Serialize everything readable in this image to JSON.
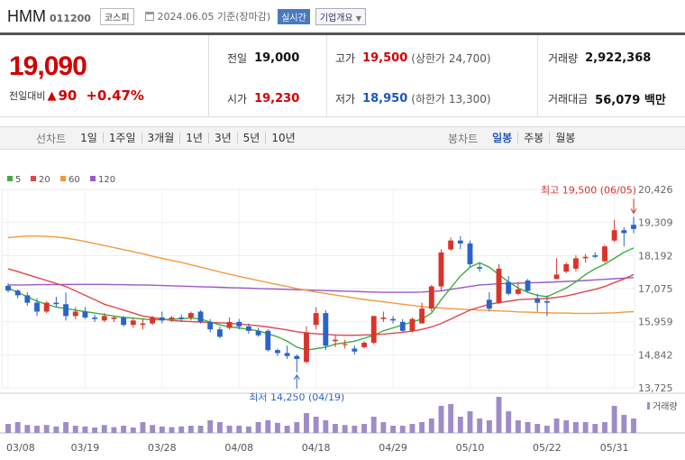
{
  "header": {
    "name": "HMM",
    "code": "011200",
    "market": "코스피",
    "date": "2024.06.05 기준(장마감)",
    "live_label": "실시간",
    "company_label": "기업개요"
  },
  "quote": {
    "price": "19,090",
    "change_label": "전일대비",
    "change_value": "90",
    "change_percent": "+0.47%",
    "prev_close_label": "전일",
    "prev_close": "19,000",
    "high_label": "고가",
    "high": "19,500",
    "upper_limit": "(상한가 24,700)",
    "volume_label": "거래량",
    "volume": "2,922,368",
    "open_label": "시가",
    "open": "19,230",
    "low_label": "저가",
    "low": "18,950",
    "lower_limit": "(하한가 13,300)",
    "trade_value_label": "거래대금",
    "trade_value": "56,079 백만"
  },
  "toolbar": {
    "line_chart_label": "선차트",
    "periods": [
      "1일",
      "1주일",
      "3개월",
      "1년",
      "3년",
      "5년",
      "10년"
    ],
    "candle_label": "봉차트",
    "candle_periods": [
      "일봉",
      "주봉",
      "월봉"
    ],
    "active_candle": "일봉"
  },
  "colors": {
    "up": "#d9342b",
    "down": "#2a64c8",
    "ma5": "#3dae3d",
    "ma20": "#e0474c",
    "ma60": "#f29a3c",
    "ma120": "#9a59c9",
    "volume": "#9d8cc8"
  },
  "chart_data": {
    "type": "candlestick",
    "y_ticks": [
      "20,426",
      "19,309",
      "18,192",
      "17,075",
      "15,959",
      "14,842",
      "13,725"
    ],
    "ylim": [
      13725,
      20426
    ],
    "x_ticks": [
      "03/08",
      "03/19",
      "03/28",
      "04/08",
      "04/18",
      "04/29",
      "05/10",
      "05/22",
      "05/31"
    ],
    "legend": [
      "5",
      "20",
      "60",
      "120"
    ],
    "high_annotation": "최고 19,500 (06/05)",
    "low_annotation": "최저 14,250 (04/19)",
    "volume_label": "거래량",
    "candles": [
      {
        "o": 17170,
        "h": 17250,
        "l": 16950,
        "c": 17010
      },
      {
        "o": 17010,
        "h": 17050,
        "l": 16750,
        "c": 16850
      },
      {
        "o": 16850,
        "h": 16950,
        "l": 16500,
        "c": 16600
      },
      {
        "o": 16600,
        "h": 16750,
        "l": 16150,
        "c": 16300
      },
      {
        "o": 16300,
        "h": 16650,
        "l": 16250,
        "c": 16600
      },
      {
        "o": 16600,
        "h": 16800,
        "l": 16450,
        "c": 16550
      },
      {
        "o": 16550,
        "h": 16950,
        "l": 16000,
        "c": 16150
      },
      {
        "o": 16150,
        "h": 16450,
        "l": 16050,
        "c": 16300
      },
      {
        "o": 16300,
        "h": 16450,
        "l": 16050,
        "c": 16100
      },
      {
        "o": 16100,
        "h": 16200,
        "l": 15950,
        "c": 16050
      },
      {
        "o": 16000,
        "h": 16250,
        "l": 15950,
        "c": 16150
      },
      {
        "o": 16050,
        "h": 16150,
        "l": 15950,
        "c": 16100
      },
      {
        "o": 16100,
        "h": 16150,
        "l": 15800,
        "c": 15850
      },
      {
        "o": 15850,
        "h": 16100,
        "l": 15750,
        "c": 16000
      },
      {
        "o": 15850,
        "h": 16050,
        "l": 15700,
        "c": 15900
      },
      {
        "o": 15900,
        "h": 16150,
        "l": 15850,
        "c": 16100
      },
      {
        "o": 16100,
        "h": 16300,
        "l": 15900,
        "c": 16000
      },
      {
        "o": 16050,
        "h": 16150,
        "l": 15950,
        "c": 16100
      },
      {
        "o": 16100,
        "h": 16200,
        "l": 15950,
        "c": 16050
      },
      {
        "o": 16100,
        "h": 16300,
        "l": 16000,
        "c": 16250
      },
      {
        "o": 16300,
        "h": 16350,
        "l": 15900,
        "c": 15950
      },
      {
        "o": 15950,
        "h": 16050,
        "l": 15600,
        "c": 15700
      },
      {
        "o": 15700,
        "h": 15800,
        "l": 15400,
        "c": 15450
      },
      {
        "o": 15750,
        "h": 16100,
        "l": 15700,
        "c": 15950
      },
      {
        "o": 15950,
        "h": 16050,
        "l": 15700,
        "c": 15800
      },
      {
        "o": 15800,
        "h": 15900,
        "l": 15550,
        "c": 15650
      },
      {
        "o": 15650,
        "h": 15750,
        "l": 15450,
        "c": 15500
      },
      {
        "o": 15650,
        "h": 15700,
        "l": 14950,
        "c": 15000
      },
      {
        "o": 15000,
        "h": 15050,
        "l": 14800,
        "c": 14900
      },
      {
        "o": 14900,
        "h": 15150,
        "l": 14700,
        "c": 14800
      },
      {
        "o": 14800,
        "h": 14850,
        "l": 14250,
        "c": 14700
      },
      {
        "o": 14600,
        "h": 15800,
        "l": 14550,
        "c": 15600
      },
      {
        "o": 15850,
        "h": 16450,
        "l": 15700,
        "c": 16250
      },
      {
        "o": 16250,
        "h": 16350,
        "l": 15000,
        "c": 15150
      },
      {
        "o": 15300,
        "h": 15500,
        "l": 15100,
        "c": 15350
      },
      {
        "o": 15200,
        "h": 15350,
        "l": 15050,
        "c": 15200
      },
      {
        "o": 15050,
        "h": 15150,
        "l": 14850,
        "c": 14950
      },
      {
        "o": 15100,
        "h": 15300,
        "l": 15050,
        "c": 15250
      },
      {
        "o": 15250,
        "h": 16150,
        "l": 15200,
        "c": 16150
      },
      {
        "o": 16050,
        "h": 16300,
        "l": 15950,
        "c": 16100
      },
      {
        "o": 16050,
        "h": 16150,
        "l": 15900,
        "c": 16000
      },
      {
        "o": 15950,
        "h": 16050,
        "l": 15600,
        "c": 15650
      },
      {
        "o": 15650,
        "h": 16100,
        "l": 15600,
        "c": 16050
      },
      {
        "o": 15900,
        "h": 16600,
        "l": 15900,
        "c": 16400
      },
      {
        "o": 16400,
        "h": 17200,
        "l": 16300,
        "c": 17150
      },
      {
        "o": 17150,
        "h": 18400,
        "l": 17000,
        "c": 18300
      },
      {
        "o": 18400,
        "h": 18800,
        "l": 18350,
        "c": 18700
      },
      {
        "o": 18700,
        "h": 18850,
        "l": 18400,
        "c": 18600
      },
      {
        "o": 18600,
        "h": 18700,
        "l": 17800,
        "c": 17900
      },
      {
        "o": 17800,
        "h": 17950,
        "l": 17650,
        "c": 17750
      },
      {
        "o": 16700,
        "h": 16950,
        "l": 16300,
        "c": 16400
      },
      {
        "o": 16600,
        "h": 17900,
        "l": 16550,
        "c": 17750
      },
      {
        "o": 17300,
        "h": 17500,
        "l": 16850,
        "c": 16900
      },
      {
        "o": 16900,
        "h": 17300,
        "l": 16850,
        "c": 17050
      },
      {
        "o": 17350,
        "h": 17400,
        "l": 16950,
        "c": 17000
      },
      {
        "o": 16750,
        "h": 16900,
        "l": 16300,
        "c": 16600
      },
      {
        "o": 16650,
        "h": 16850,
        "l": 16150,
        "c": 16600
      },
      {
        "o": 17400,
        "h": 18100,
        "l": 17400,
        "c": 17550
      },
      {
        "o": 17650,
        "h": 17950,
        "l": 17600,
        "c": 17900
      },
      {
        "o": 17750,
        "h": 18200,
        "l": 17650,
        "c": 18100
      },
      {
        "o": 18100,
        "h": 18250,
        "l": 17950,
        "c": 18150
      },
      {
        "o": 18200,
        "h": 18300,
        "l": 18100,
        "c": 18150
      },
      {
        "o": 18000,
        "h": 18550,
        "l": 17950,
        "c": 18500
      },
      {
        "o": 18700,
        "h": 19400,
        "l": 18650,
        "c": 19050
      },
      {
        "o": 19050,
        "h": 19150,
        "l": 18500,
        "c": 18950
      },
      {
        "o": 19230,
        "h": 19500,
        "l": 18950,
        "c": 19090
      }
    ],
    "volumes": [
      0.25,
      0.3,
      0.22,
      0.2,
      0.22,
      0.18,
      0.3,
      0.2,
      0.18,
      0.15,
      0.22,
      0.16,
      0.2,
      0.15,
      0.3,
      0.22,
      0.18,
      0.16,
      0.18,
      0.2,
      0.2,
      0.35,
      0.3,
      0.2,
      0.2,
      0.18,
      0.3,
      0.35,
      0.28,
      0.2,
      0.3,
      0.55,
      0.45,
      0.35,
      0.25,
      0.22,
      0.2,
      0.25,
      0.45,
      0.3,
      0.2,
      0.2,
      0.25,
      0.3,
      0.4,
      0.75,
      0.8,
      0.45,
      0.6,
      0.4,
      0.35,
      1.0,
      0.6,
      0.35,
      0.3,
      0.25,
      0.2,
      0.4,
      0.35,
      0.3,
      0.3,
      0.25,
      0.3,
      0.75,
      0.5,
      0.4
    ],
    "ma5": [
      17100,
      16950,
      16800,
      16650,
      16550,
      16450,
      16400,
      16350,
      16300,
      16250,
      16200,
      16150,
      16100,
      16080,
      16050,
      16020,
      16030,
      16040,
      16060,
      16080,
      16050,
      15950,
      15850,
      15780,
      15750,
      15700,
      15650,
      15550,
      15450,
      15300,
      15100,
      15000,
      15050,
      15100,
      15200,
      15250,
      15300,
      15400,
      15500,
      15650,
      15750,
      15850,
      15950,
      16050,
      16250,
      16700,
      17100,
      17500,
      17800,
      17950,
      17800,
      17550,
      17300,
      17100,
      16950,
      16850,
      16800,
      16950,
      17100,
      17300,
      17550,
      17750,
      17900,
      18100,
      18300,
      18450
    ],
    "ma20": [
      17750,
      17650,
      17550,
      17450,
      17350,
      17250,
      17150,
      17000,
      16850,
      16700,
      16550,
      16450,
      16350,
      16250,
      16150,
      16100,
      16050,
      16000,
      15980,
      15960,
      15950,
      15930,
      15920,
      15900,
      15880,
      15850,
      15820,
      15780,
      15730,
      15680,
      15620,
      15580,
      15550,
      15530,
      15510,
      15500,
      15500,
      15510,
      15520,
      15540,
      15570,
      15600,
      15640,
      15700,
      15780,
      15900,
      16050,
      16200,
      16350,
      16450,
      16550,
      16600,
      16650,
      16700,
      16720,
      16730,
      16740,
      16780,
      16830,
      16900,
      16980,
      17050,
      17150,
      17280,
      17400,
      17550
    ],
    "ma60": [
      18800,
      18830,
      18850,
      18850,
      18840,
      18820,
      18780,
      18730,
      18670,
      18600,
      18530,
      18460,
      18390,
      18320,
      18250,
      18170,
      18100,
      18030,
      17960,
      17880,
      17800,
      17720,
      17640,
      17560,
      17490,
      17420,
      17350,
      17280,
      17210,
      17150,
      17080,
      17020,
      16960,
      16910,
      16860,
      16810,
      16760,
      16710,
      16670,
      16630,
      16590,
      16550,
      16510,
      16470,
      16440,
      16420,
      16400,
      16380,
      16370,
      16350,
      16340,
      16320,
      16310,
      16290,
      16280,
      16270,
      16260,
      16250,
      16250,
      16240,
      16240,
      16240,
      16250,
      16260,
      16280,
      16300
    ],
    "ma120": [
      17200,
      17200,
      17200,
      17210,
      17210,
      17210,
      17220,
      17220,
      17220,
      17220,
      17220,
      17210,
      17210,
      17200,
      17200,
      17190,
      17180,
      17170,
      17160,
      17150,
      17140,
      17130,
      17120,
      17110,
      17100,
      17090,
      17080,
      17070,
      17060,
      17050,
      17040,
      17030,
      17020,
      17010,
      17000,
      16990,
      16980,
      16970,
      16960,
      16950,
      16950,
      16950,
      16950,
      16960,
      16980,
      17000,
      17050,
      17100,
      17150,
      17200,
      17220,
      17240,
      17250,
      17260,
      17270,
      17280,
      17290,
      17300,
      17320,
      17330,
      17350,
      17370,
      17390,
      17410,
      17430,
      17450
    ]
  }
}
